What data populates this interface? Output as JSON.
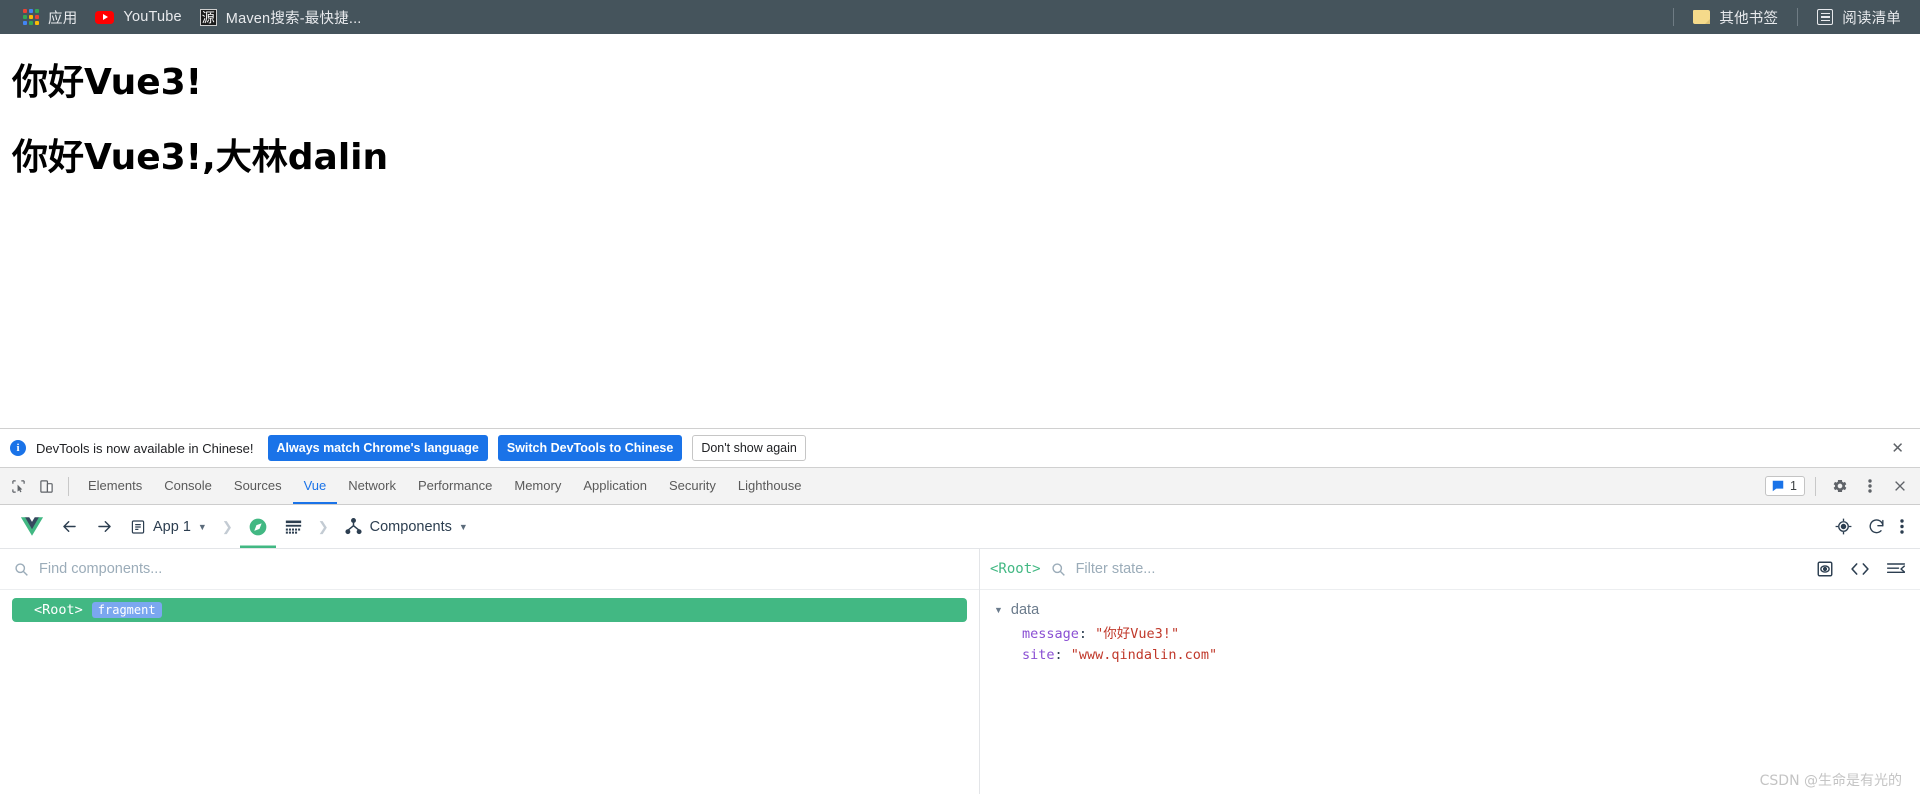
{
  "browser": {
    "bookmarks": [
      {
        "label": "应用",
        "icon": "apps-grid-icon"
      },
      {
        "label": "YouTube",
        "icon": "youtube-icon"
      },
      {
        "label": "Maven搜索-最快捷...",
        "icon": "maven-icon"
      }
    ],
    "right_items": [
      {
        "label": "其他书签",
        "icon": "folder-icon"
      },
      {
        "label": "阅读清单",
        "icon": "reading-list-icon"
      }
    ]
  },
  "page": {
    "heading1": "你好Vue3!",
    "heading2": "你好Vue3!,大林dalin"
  },
  "infobar": {
    "icon": "info-icon",
    "message": "DevTools is now available in Chinese!",
    "primary_button": "Always match Chrome's language",
    "secondary_button": "Switch DevTools to Chinese",
    "dismiss_button": "Don't show again",
    "close_icon": "close-icon",
    "accent": "#1a73e8"
  },
  "devtools": {
    "left_icons": [
      "inspect-element-icon",
      "device-toolbar-icon"
    ],
    "tabs": [
      {
        "label": "Elements",
        "active": false
      },
      {
        "label": "Console",
        "active": false
      },
      {
        "label": "Sources",
        "active": false
      },
      {
        "label": "Vue",
        "active": true
      },
      {
        "label": "Network",
        "active": false
      },
      {
        "label": "Performance",
        "active": false
      },
      {
        "label": "Memory",
        "active": false
      },
      {
        "label": "Application",
        "active": false
      },
      {
        "label": "Security",
        "active": false
      },
      {
        "label": "Lighthouse",
        "active": false
      }
    ],
    "message_count": "1",
    "right_icons": [
      "message-icon",
      "settings-gear-icon",
      "more-options-icon",
      "close-devtools-icon"
    ],
    "active_tab_color": "#1a73e8"
  },
  "vue_toolbar": {
    "logo": "vue-logo-icon",
    "back_icon": "back-arrow-icon",
    "forward_icon": "forward-arrow-icon",
    "app_label": "App 1",
    "app_icon": "app-instance-icon",
    "app_dropdown_icon": "chevron-down-icon",
    "separator_icon": "chevron-right-icon",
    "compass_icon": "compass-icon",
    "timeline_icon": "timeline-grid-icon",
    "view_label": "Components",
    "view_icon": "component-tree-icon",
    "view_dropdown_icon": "chevron-down-icon",
    "right_icons": [
      "select-target-icon",
      "refresh-icon",
      "more-options-icon"
    ],
    "accent": "#42b883"
  },
  "components_pane": {
    "search_placeholder": "Find components...",
    "search_value": "",
    "search_icon": "search-icon",
    "tree": [
      {
        "tag": "<Root>",
        "badge": "fragment",
        "selected": true
      }
    ]
  },
  "state_pane": {
    "root_tag": "<Root>",
    "filter_placeholder": "Filter state...",
    "filter_value": "",
    "search_icon": "search-icon",
    "toolbar_icons": [
      "inspect-component-icon",
      "open-in-editor-icon",
      "collapse-all-icon"
    ],
    "groups": [
      {
        "name": "data",
        "expanded_icon": "triangle-down-icon",
        "entries": [
          {
            "key": "message",
            "value": "\"你好Vue3!\""
          },
          {
            "key": "site",
            "value": "\"www.qindalin.com\""
          }
        ]
      }
    ]
  },
  "watermark": "CSDN @生命是有光的"
}
